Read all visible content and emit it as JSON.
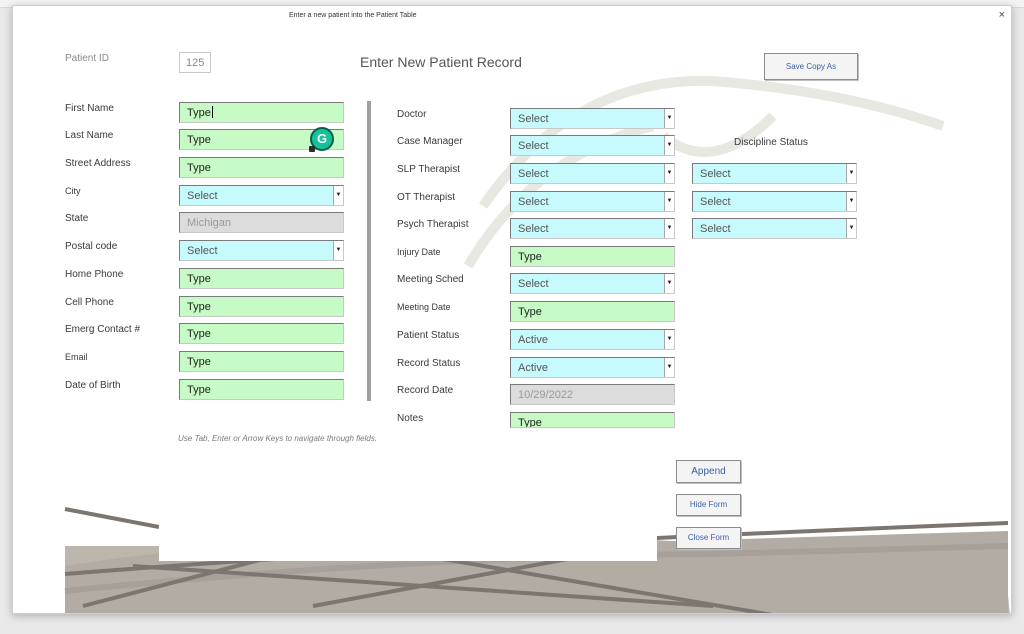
{
  "window": {
    "title": "Enter a new patient into the Patient Table",
    "close_glyph": "×"
  },
  "form": {
    "heading": "Enter New Patient Record",
    "patient_id_label": "Patient ID",
    "patient_id_value": "125",
    "save_copy_label": "Save Copy As",
    "hint": "Use Tab, Enter or Arrow Keys to navigate through fields.",
    "discipline_status_label": "Discipline Status"
  },
  "left_fields": [
    {
      "label": "First Name",
      "value": "Type",
      "style": "green"
    },
    {
      "label": "Last Name",
      "value": "Type",
      "style": "green"
    },
    {
      "label": "Street Address",
      "value": "Type",
      "style": "green"
    },
    {
      "label": "City",
      "value": "Select",
      "style": "cyan-dropdown"
    },
    {
      "label": "State",
      "value": "Michigan",
      "style": "grey"
    },
    {
      "label": "Postal code",
      "value": "Select",
      "style": "cyan-dropdown"
    },
    {
      "label": "Home Phone",
      "value": "Type",
      "style": "green"
    },
    {
      "label": "Cell Phone",
      "value": "Type",
      "style": "green"
    },
    {
      "label": "Emerg Contact #",
      "value": "Type",
      "style": "green"
    },
    {
      "label": "Email",
      "value": "Type",
      "style": "green"
    },
    {
      "label": "Date of Birth",
      "value": "Type",
      "style": "green"
    }
  ],
  "right_fields": [
    {
      "label": "Doctor",
      "value": "Select",
      "style": "cyan-dropdown"
    },
    {
      "label": "Case Manager",
      "value": "Select",
      "style": "cyan-dropdown"
    },
    {
      "label": "SLP Therapist",
      "value": "Select",
      "style": "cyan-dropdown"
    },
    {
      "label": "OT Therapist",
      "value": "Select",
      "style": "cyan-dropdown"
    },
    {
      "label": "Psych Therapist",
      "value": "Select",
      "style": "cyan-dropdown"
    },
    {
      "label": "Injury Date",
      "value": "Type",
      "style": "green"
    },
    {
      "label": "Meeting Sched",
      "value": "Select",
      "style": "cyan-dropdown"
    },
    {
      "label": "Meeting Date",
      "value": "Type",
      "style": "green"
    },
    {
      "label": "Patient Status",
      "value": "Active",
      "style": "cyan-dropdown"
    },
    {
      "label": "Record Status",
      "value": "Active",
      "style": "cyan-dropdown"
    },
    {
      "label": "Record Date",
      "value": "10/29/2022",
      "style": "grey"
    },
    {
      "label": "Notes",
      "value": "Type",
      "style": "green"
    }
  ],
  "discipline_fields": [
    {
      "value": "Select"
    },
    {
      "value": "Select"
    },
    {
      "value": "Select"
    }
  ],
  "buttons": {
    "append": "Append",
    "hide_form": "Hide Form",
    "close_form": "Close Form"
  },
  "icons": {
    "grammarly": "grammarly-icon",
    "dropdown": "chevron-down-icon",
    "close": "close-icon"
  },
  "colors": {
    "text_field_bg": "#c7fbc5",
    "dropdown_bg": "#c6fafd",
    "disabled_bg": "#dcdcdc",
    "button_text": "#3b5fa8"
  }
}
